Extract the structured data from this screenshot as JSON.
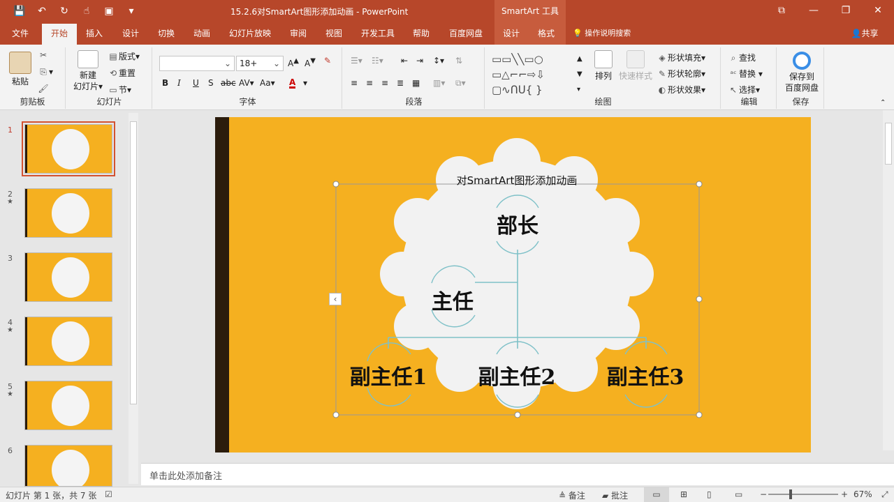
{
  "window": {
    "doc_title": "15.2.6对SmartArt图形添加动画 - PowerPoint",
    "context_tab_title": "SmartArt 工具",
    "qat": [
      "save-icon",
      "undo-icon",
      "redo-icon",
      "touch-mode-icon",
      "customize-icon"
    ]
  },
  "tabs": [
    "文件",
    "开始",
    "插入",
    "设计",
    "切换",
    "动画",
    "幻灯片放映",
    "审阅",
    "视图",
    "开发工具",
    "帮助",
    "百度网盘",
    "设计",
    "格式"
  ],
  "tell_me": "操作说明搜索",
  "share": "共享",
  "ribbon": {
    "clipboard": {
      "paste": "粘贴",
      "label": "剪贴板"
    },
    "slides": {
      "new_slide": "新建",
      "new_slide2": "幻灯片",
      "layout": "版式",
      "reset": "重置",
      "section": "节",
      "label": "幻灯片"
    },
    "font": {
      "font_name": "",
      "font_size": "18+",
      "label": "字体"
    },
    "paragraph": {
      "label": "段落"
    },
    "drawing": {
      "arrange": "排列",
      "quick_styles": "快速样式",
      "fill": "形状填充",
      "outline": "形状轮廓",
      "effects": "形状效果",
      "label": "绘图"
    },
    "editing": {
      "find": "查找",
      "replace": "替换",
      "select": "选择",
      "label": "编辑"
    },
    "save": {
      "save_to": "保存到",
      "baidu": "百度网盘",
      "label": "保存"
    }
  },
  "thumbnails": [
    {
      "num": "1",
      "star": ""
    },
    {
      "num": "2",
      "star": "★"
    },
    {
      "num": "3",
      "star": ""
    },
    {
      "num": "4",
      "star": "★"
    },
    {
      "num": "5",
      "star": "★"
    },
    {
      "num": "6",
      "star": ""
    }
  ],
  "slide": {
    "title": "对SmartArt图形添加动画",
    "nodes": {
      "top": "部长",
      "assistant": "主任",
      "sub1": "副主任1",
      "sub2": "副主任2",
      "sub3": "副主任3"
    }
  },
  "notes_placeholder": "单击此处添加备注",
  "status": {
    "slide_info": "幻灯片 第 1 张，共 7 张",
    "notes": "备注",
    "comments": "批注",
    "zoom": "67%"
  },
  "colors": {
    "brand": "#b7472a",
    "slide_bg": "#f5b020",
    "connector": "#7fc1c8"
  }
}
